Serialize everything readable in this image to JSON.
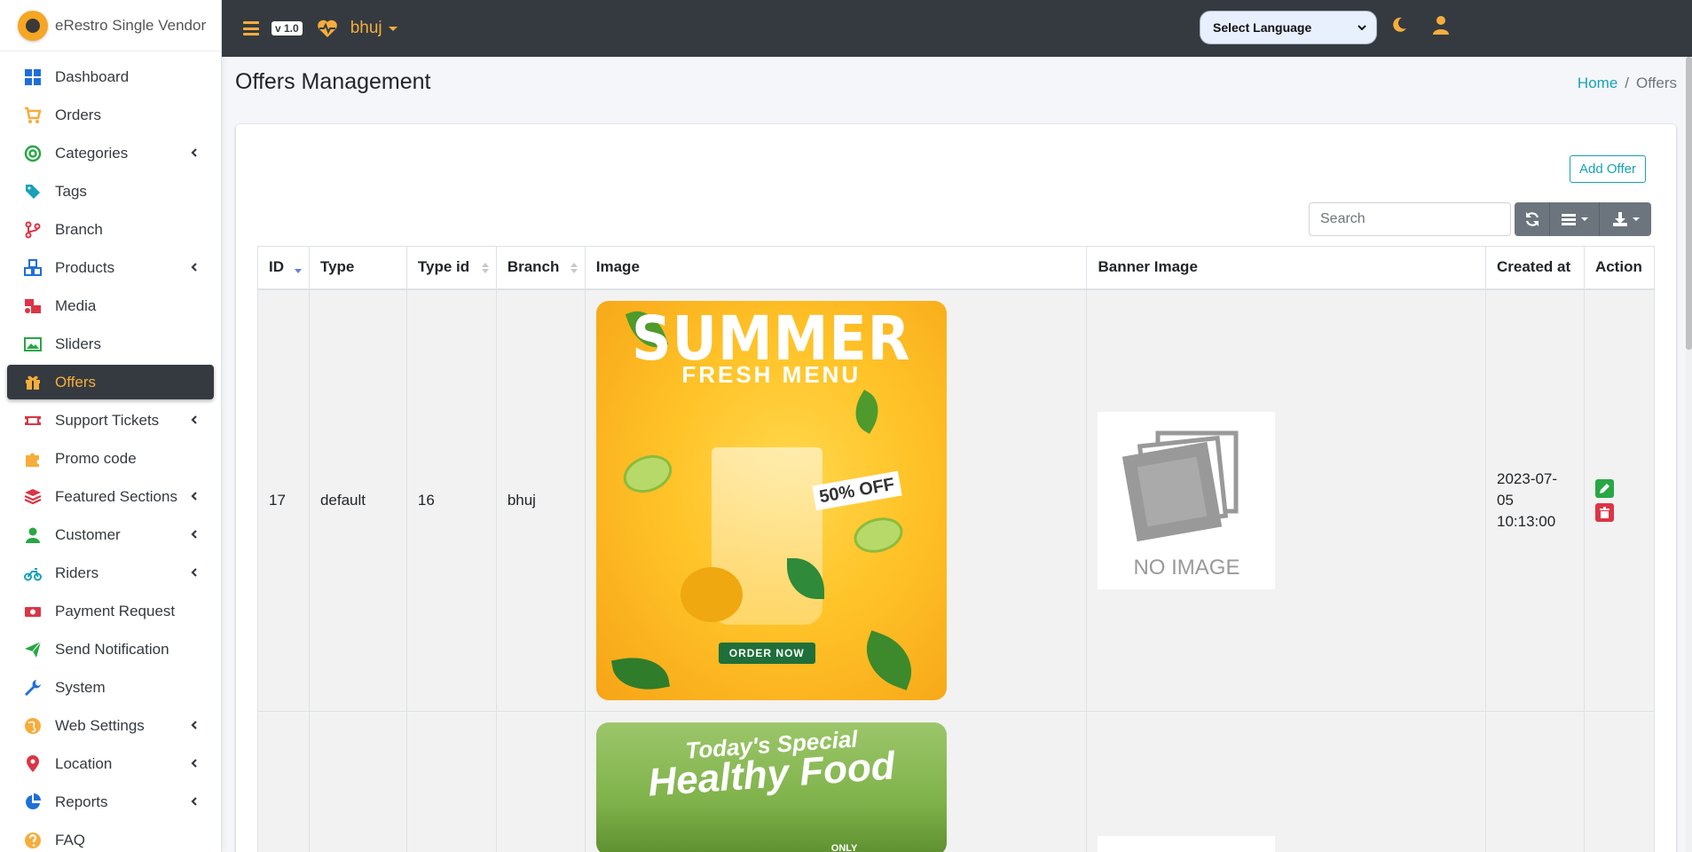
{
  "app": {
    "brand_name": "eRestro Single Vendor",
    "version": "v 1.0",
    "branch": "bhuj"
  },
  "colors": {
    "accent": "#f6ad3b",
    "topbar": "#343a40",
    "info": "#17a2b8",
    "success": "#28a745",
    "danger": "#dc3545"
  },
  "sidebar": {
    "items": [
      {
        "label": "Dashboard",
        "icon": "dashboard-icon",
        "color": "#1e6fd9",
        "submenu": false
      },
      {
        "label": "Orders",
        "icon": "cart-icon",
        "color": "#f6ad3b",
        "submenu": false
      },
      {
        "label": "Categories",
        "icon": "target-icon",
        "color": "#28a745",
        "submenu": true
      },
      {
        "label": "Tags",
        "icon": "tag-icon",
        "color": "#17a2b8",
        "submenu": false
      },
      {
        "label": "Branch",
        "icon": "branch-icon",
        "color": "#dc3545",
        "submenu": false
      },
      {
        "label": "Products",
        "icon": "cubes-icon",
        "color": "#1e6fd9",
        "submenu": true
      },
      {
        "label": "Media",
        "icon": "photo-video-icon",
        "color": "#dc3545",
        "submenu": false
      },
      {
        "label": "Sliders",
        "icon": "image-icon",
        "color": "#28a745",
        "submenu": false
      },
      {
        "label": "Offers",
        "icon": "gift-icon",
        "color": "#f6ad3b",
        "submenu": false,
        "active": true
      },
      {
        "label": "Support Tickets",
        "icon": "ticket-icon",
        "color": "#dc3545",
        "submenu": true
      },
      {
        "label": "Promo code",
        "icon": "puzzle-icon",
        "color": "#f6ad3b",
        "submenu": false
      },
      {
        "label": "Featured Sections",
        "icon": "layers-icon",
        "color": "#dc3545",
        "submenu": true
      },
      {
        "label": "Customer",
        "icon": "user-icon",
        "color": "#28a745",
        "submenu": true
      },
      {
        "label": "Riders",
        "icon": "motorcycle-icon",
        "color": "#17a2b8",
        "submenu": true
      },
      {
        "label": "Payment Request",
        "icon": "money-icon",
        "color": "#dc3545",
        "submenu": false
      },
      {
        "label": "Send Notification",
        "icon": "paper-plane-icon",
        "color": "#28a745",
        "submenu": false
      },
      {
        "label": "System",
        "icon": "wrench-icon",
        "color": "#1e6fd9",
        "submenu": false
      },
      {
        "label": "Web Settings",
        "icon": "globe-icon",
        "color": "#f6ad3b",
        "submenu": true
      },
      {
        "label": "Location",
        "icon": "map-marker-icon",
        "color": "#dc3545",
        "submenu": true
      },
      {
        "label": "Reports",
        "icon": "pie-chart-icon",
        "color": "#1e6fd9",
        "submenu": true
      },
      {
        "label": "FAQ",
        "icon": "question-circle-icon",
        "color": "#f6ad3b",
        "submenu": false
      }
    ]
  },
  "topbar": {
    "language_select": "Select Language"
  },
  "header": {
    "title": "Offers Management",
    "breadcrumb_home": "Home",
    "breadcrumb_current": "Offers"
  },
  "toolbar": {
    "add_offer": "Add Offer",
    "search_placeholder": "Search"
  },
  "table": {
    "columns": [
      "ID",
      "Type",
      "Type id",
      "Branch",
      "Image",
      "Banner Image",
      "Created at",
      "Action"
    ],
    "rows": [
      {
        "id": "17",
        "type": "default",
        "type_id": "16",
        "branch": "bhuj",
        "image": {
          "line1": "SUMMER",
          "line2": "FRESH MENU",
          "badge": "50% OFF",
          "cta": "ORDER NOW"
        },
        "banner": "NO IMAGE",
        "created_at": "2023-07-05 10:13:00"
      },
      {
        "id": "",
        "type": "",
        "type_id": "",
        "branch": "",
        "image": {
          "line1": "Today's Special",
          "line2": "Healthy Food",
          "tag": "ONLY"
        },
        "banner": "",
        "created_at": ""
      }
    ]
  }
}
